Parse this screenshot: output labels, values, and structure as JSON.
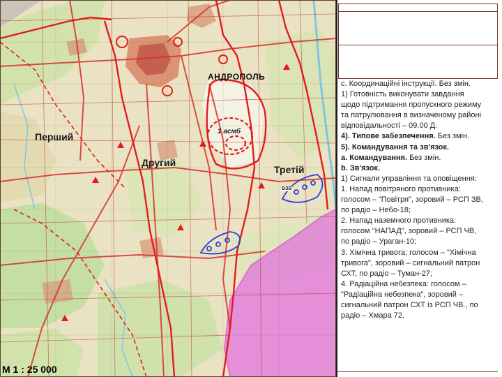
{
  "map": {
    "labels": {
      "first": "Перший",
      "second": "Другий",
      "third": "Третій",
      "unit": "1 асмб",
      "town": "АНДРОПОЛЬ",
      "small_unit": "ВЗВ"
    },
    "scale": "М 1 : 25 000",
    "colors": {
      "land": "#e9e3c4",
      "forest": "#b9d99a",
      "roads": "#d9302a",
      "water": "#7fc6e0",
      "purple_zone": "#e04ce8",
      "unit_markings": "#e21c1c",
      "blue_positions": "#2a40d8",
      "town": "#c04030"
    }
  },
  "instructions": {
    "lines": [
      {
        "text": "с. Координаційні інструкції. Без змін.",
        "bold": false
      },
      {
        "text": "1) Готовність виконувати завдання",
        "bold": false
      },
      {
        "text": "щодо підтримання пропускного режиму",
        "bold": false
      },
      {
        "text": "та патрулювання в визначеному районі",
        "bold": false
      },
      {
        "text": "відповідальності – 09.00 Д.",
        "bold": false
      },
      {
        "text": "4). Типове забезпечення.",
        "bold": true,
        "suffix": " Без змін."
      },
      {
        "text": "5). Командування та зв'язок.",
        "bold": true
      },
      {
        "text": "а. Командування.",
        "bold": true,
        "suffix": " Без змін."
      },
      {
        "text": "b. Зв'язок.",
        "bold": true
      },
      {
        "text": "1) Сигнали управління та оповіщення:",
        "bold": false
      },
      {
        "text": "1. Напад повітряного противника:",
        "bold": false
      },
      {
        "text": "голосом – \"Повітря\", зоровий – РСП ЗВ,",
        "bold": false
      },
      {
        "text": "по радіо – Небо-18;",
        "bold": false
      },
      {
        "text": "2. Напад наземного противника:",
        "bold": false
      },
      {
        "text": "голосом \"НАПАД\", зоровий – РСП ЧВ,",
        "bold": false
      },
      {
        "text": "по радіо – Ураган-10;",
        "bold": false
      },
      {
        "text": "3. Хімічна тривога: голосом – \"Хімічна",
        "bold": false
      },
      {
        "text": "тривога\", зоровий – сигнальний патрон",
        "bold": false
      },
      {
        "text": "СХТ, по радіо – Туман-27;",
        "bold": false
      },
      {
        "text": "4. Радіаційна небезпека: голосом –",
        "bold": false
      },
      {
        "text": "\"Радіаційна небезпека\", зоровий –",
        "bold": false
      },
      {
        "text": "сигнальний патрон СХТ із РСП ЧВ., по",
        "bold": false
      },
      {
        "text": "радіо – Хмара 72.",
        "bold": false
      }
    ]
  }
}
